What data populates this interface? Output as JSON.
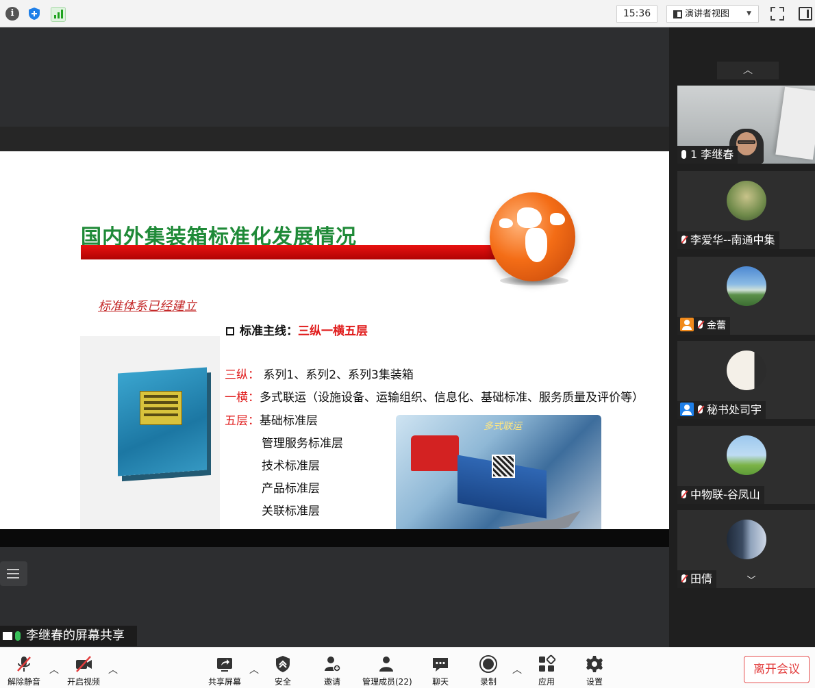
{
  "topbar": {
    "time": "15:36",
    "view_mode": "演讲者视图"
  },
  "slide": {
    "title": "国内外集装箱标准化发展情况",
    "handwritten_note": "标准体系已经建立",
    "main_line_label": "标准主线：",
    "main_line_value": "三纵一横五层",
    "rows": [
      {
        "key": "三纵：",
        "text": " 系列1、系列2、系列3集装箱"
      },
      {
        "key": "一横：",
        "text": "多式联运（设施设备、运输组织、信息化、基础标准、服务质量及评价等）"
      },
      {
        "key": "五层：",
        "text": "基础标准层"
      }
    ],
    "layers_extra": [
      "管理服务标准层",
      "技术标准层",
      "产品标准层",
      "关联标准层"
    ],
    "image_caption": "多式联运"
  },
  "share": {
    "label": "李继春的屏幕共享"
  },
  "participants": [
    {
      "name": "1 李继春",
      "type": "video",
      "mic": "on"
    },
    {
      "name": "李爱华--南通中集",
      "type": "avatar",
      "mic": "muted"
    },
    {
      "name": "金蕾",
      "type": "avatar",
      "mic": "muted",
      "badge": "orange"
    },
    {
      "name": "秘书处司宇",
      "type": "avatar",
      "mic": "muted",
      "badge": "blue"
    },
    {
      "name": "中物联-谷凤山",
      "type": "avatar",
      "mic": "muted"
    },
    {
      "name": "田倩",
      "type": "avatar",
      "mic": "muted"
    }
  ],
  "toolbar": {
    "unmute": "解除静音",
    "start_video": "开启视频",
    "share_screen": "共享屏幕",
    "security": "安全",
    "invite": "邀请",
    "manage_members": "管理成员(22)",
    "chat": "聊天",
    "record": "录制",
    "apps": "应用",
    "settings": "设置",
    "leave": "离开会议"
  },
  "colors": {
    "title_green": "#1f8a38",
    "accent_red": "#e01b1b",
    "leave_red": "#e23c3c",
    "panel_bg": "#1f1f1f"
  }
}
